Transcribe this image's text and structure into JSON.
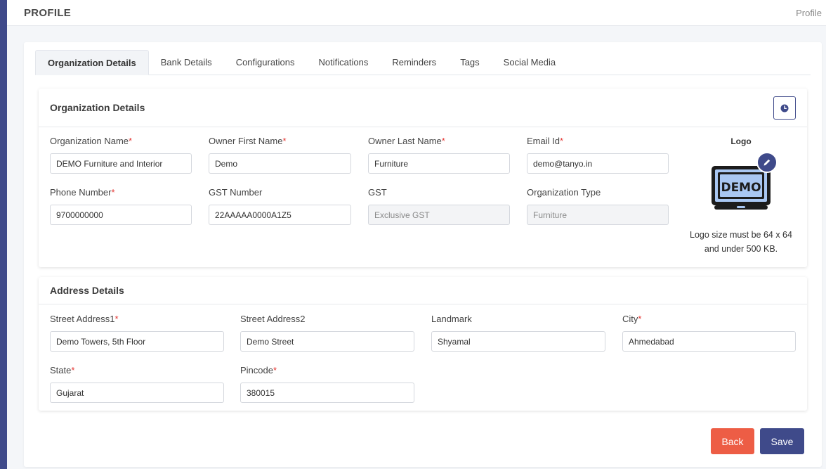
{
  "header": {
    "title": "PROFILE",
    "breadcrumb": "Profile"
  },
  "tabs": [
    {
      "label": "Organization Details",
      "active": true
    },
    {
      "label": "Bank Details"
    },
    {
      "label": "Configurations"
    },
    {
      "label": "Notifications"
    },
    {
      "label": "Reminders"
    },
    {
      "label": "Tags"
    },
    {
      "label": "Social Media"
    }
  ],
  "org": {
    "title": "Organization Details",
    "history_icon": "clock-icon",
    "fields": {
      "org_name": {
        "label": "Organization Name",
        "required": "*",
        "value": "DEMO Furniture and Interior"
      },
      "first_name": {
        "label": "Owner First Name",
        "required": "*",
        "value": "Demo"
      },
      "last_name": {
        "label": "Owner Last Name",
        "required": "*",
        "value": "Furniture"
      },
      "email": {
        "label": "Email Id",
        "required": "*",
        "value": "demo@tanyo.in"
      },
      "phone": {
        "label": "Phone Number",
        "required": "*",
        "value": "9700000000"
      },
      "gst_number": {
        "label": "GST Number",
        "value": "22AAAAA0000A1Z5"
      },
      "gst": {
        "label": "GST",
        "value": "Exclusive GST"
      },
      "org_type": {
        "label": "Organization Type",
        "value": "Furniture"
      }
    },
    "logo": {
      "title": "Logo",
      "logo_text": "DEMO",
      "note": "Logo size must be 64 x 64 and under 500 KB.",
      "edit_icon": "pencil-icon"
    }
  },
  "address": {
    "title": "Address Details",
    "fields": {
      "street1": {
        "label": "Street Address1",
        "required": "*",
        "value": "Demo Towers, 5th Floor"
      },
      "street2": {
        "label": "Street Address2",
        "value": "Demo Street"
      },
      "landmark": {
        "label": "Landmark",
        "value": "Shyamal"
      },
      "city": {
        "label": "City",
        "required": "*",
        "value": "Ahmedabad"
      },
      "state": {
        "label": "State",
        "required": "*",
        "value": "Gujarat"
      },
      "pincode": {
        "label": "Pincode",
        "required": "*",
        "value": "380015"
      }
    }
  },
  "actions": {
    "back": "Back",
    "save": "Save"
  },
  "colors": {
    "primary": "#3f4a8a",
    "danger": "#ed5d45",
    "required": "#e53935"
  }
}
